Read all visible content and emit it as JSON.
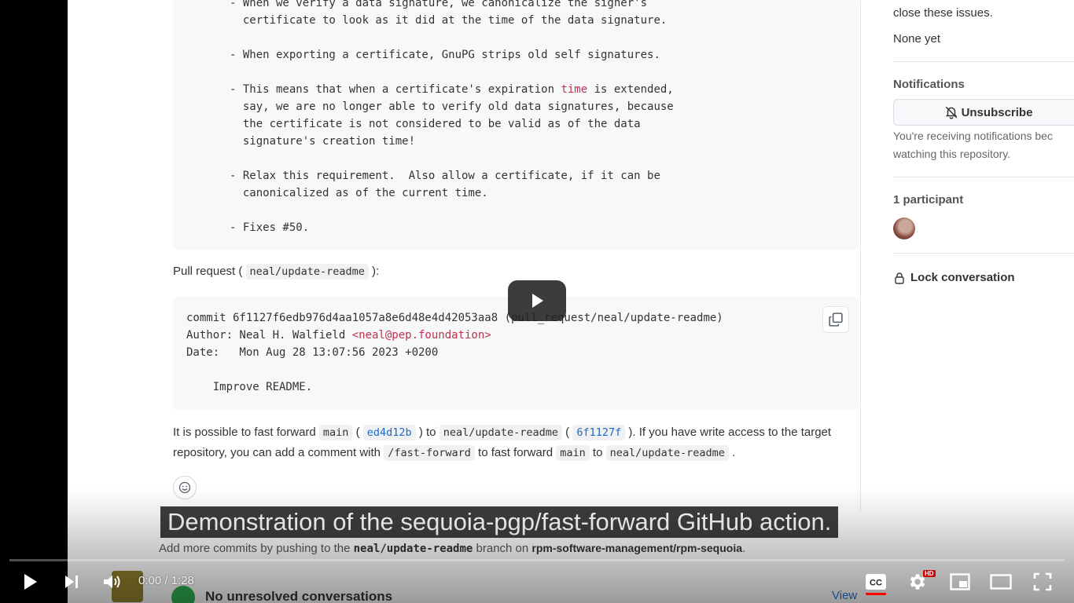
{
  "commit_text": {
    "bullet1_line1": "- When we verify a data signature, we canonicalize the signer's",
    "bullet1_line2": "  certificate to look as it did at the time of the data signature.",
    "bullet2": "- When exporting a certificate, GnuPG strips old self signatures.",
    "bullet3_a": "- This means that when a certificate's expiration ",
    "bullet3_kw": "time",
    "bullet3_b": " is extended,",
    "bullet3_line2": "  say, we are no longer able to verify old data signatures, because",
    "bullet3_line3": "  the certificate is not considered to be valid as of the data",
    "bullet3_line4": "  signature's creation time!",
    "bullet4_line1": "- Relax this requirement.  Also allow a certificate, if it can be",
    "bullet4_line2": "  canonicalized as of the current time.",
    "bullet5": "- Fixes #50."
  },
  "pull_request": {
    "prefix": "Pull request (",
    "branch": "neal/update-readme",
    "suffix": "):"
  },
  "commit_block": {
    "commit_line": "commit 6f1127f6edb976d4aa1057a8e6d48e4d42053aa8 (pull_request/neal/update-readme)",
    "author_label": "Author: Neal H. Walfield ",
    "author_email": "<neal@pep.foundation>",
    "date_line": "Date:   Mon Aug 28 13:07:56 2023 +0200",
    "message": "    Improve README."
  },
  "fast_forward": {
    "t1": "It is possible to fast forward ",
    "main": "main",
    "t2": " ( ",
    "sha_main": "ed4d12b",
    "t3": " ) to ",
    "branch": "neal/update-readme",
    "t4": " ( ",
    "sha_branch": "6f1127f",
    "t5": " ). If you have write access to the target repository, you can add a comment with ",
    "command": "/fast-forward",
    "t6": " to fast forward ",
    "main2": "main",
    "t7": " to ",
    "branch2": "neal/update-readme",
    "t8": " ."
  },
  "sidebar": {
    "issues_text": "close these issues.",
    "none_yet": "None yet",
    "notifications_heading": "Notifications",
    "unsubscribe_label": "Unsubscribe",
    "notif_desc_1": "You're receiving notifications bec",
    "notif_desc_2": "watching this repository.",
    "participants_heading": "1 participant",
    "lock_label": "Lock conversation"
  },
  "branch_note": {
    "t1": "Add more commits by pushing to the ",
    "branch": "neal/update-readme",
    "t2": " branch on ",
    "repo": "rpm-software-management/rpm-sequoia",
    "t3": "."
  },
  "merge_status": {
    "unresolved": "No unresolved conversations",
    "view": "View"
  },
  "player": {
    "caption": "Demonstration of the sequoia-pgp/fast-forward GitHub action.",
    "time_display": "0:00 / 1:28",
    "progress": 0,
    "hd_badge": "HD",
    "cc_label": "CC"
  },
  "icons": [
    "play-icon",
    "next-icon",
    "volume-icon",
    "cc-icon",
    "settings-icon",
    "miniplayer-icon",
    "theater-icon",
    "fullscreen-icon",
    "copy-icon",
    "smiley-icon",
    "bell-slash-icon",
    "lock-icon",
    "check-icon"
  ],
  "colors": {
    "accent_red": "#ff0000",
    "link_blue": "#1d6cc7",
    "keyword_red": "#c5304a",
    "success_green": "#2da44e"
  }
}
